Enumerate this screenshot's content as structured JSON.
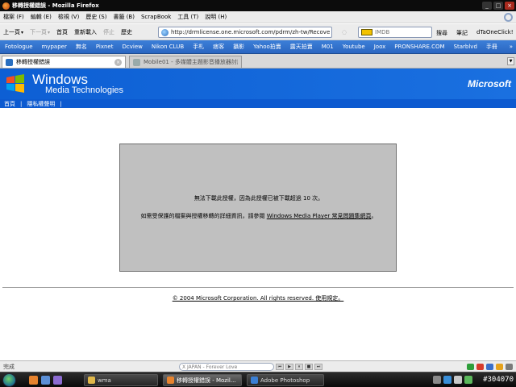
{
  "window": {
    "title": "移轉授權錯誤 - Mozilla Firefox"
  },
  "menubar": {
    "items": [
      "檔案 (F)",
      "編輯 (E)",
      "檢視 (V)",
      "歷史 (S)",
      "書籤 (B)",
      "ScrapBook",
      "工具 (T)",
      "說明 (H)"
    ]
  },
  "navbar": {
    "buttons": [
      {
        "label": "上一頁",
        "disabled": false
      },
      {
        "label": "下一頁",
        "disabled": true
      },
      {
        "label": "首頁",
        "disabled": false
      },
      {
        "label": "重新載入",
        "disabled": false
      },
      {
        "label": "停止",
        "disabled": true
      },
      {
        "label": "歷史",
        "disabled": false
      }
    ],
    "url": "http://drmlicense.one.microsoft.com/pdrm/zh-tw/Recove",
    "search_placeholder": "IMDB",
    "right_buttons": [
      "搜尋",
      "筆記",
      "dTaOneClick!"
    ]
  },
  "bookmarks": [
    "Fotologue",
    "mypaper",
    "無名",
    "Pixnet",
    "Dcview",
    "Nikon CLUB",
    "手札",
    "痞客",
    "攝影",
    "Yahoo拍賣",
    "露天拍賣",
    "M01",
    "Youtube",
    "Joox",
    "PRONSHARE.COM",
    "Starblvd",
    "手冊"
  ],
  "tabs": {
    "active": "移轉授權錯誤",
    "inactive": "Mobile01 - 多媒體主題影音播放器討論..."
  },
  "page": {
    "brand_title": "Windows",
    "brand_subtitle": "Media Technologies",
    "ms_brand": "Microsoft",
    "nav": [
      "首頁",
      "隱私權聲明"
    ],
    "message_line1": "無法下載此授權，因為此授權已被下載超過 10 次。",
    "message_line2_prefix": "如需受保護的檔案與授權移轉的詳細資訊，請參閱",
    "message_line2_link": "Windows Media Player 常見問題集網頁",
    "message_line2_suffix": "。",
    "footer": "© 2004 Microsoft Corporation. All rights reserved. 使用規定。"
  },
  "statusbar": {
    "status": "完成",
    "track": "X JAPAN - Forever Love"
  },
  "taskbar": {
    "tasks": [
      {
        "label": "wma",
        "active": false
      },
      {
        "label": "移轉授權錯誤 - Mozil...",
        "active": true
      },
      {
        "label": "Adobe Photoshop",
        "active": false
      }
    ],
    "clock": "#304070"
  },
  "colors": {
    "header_blue": "#0d5fd4",
    "bookmark_blue": "#2a66c1",
    "msg_gray": "#c0c0c0"
  }
}
